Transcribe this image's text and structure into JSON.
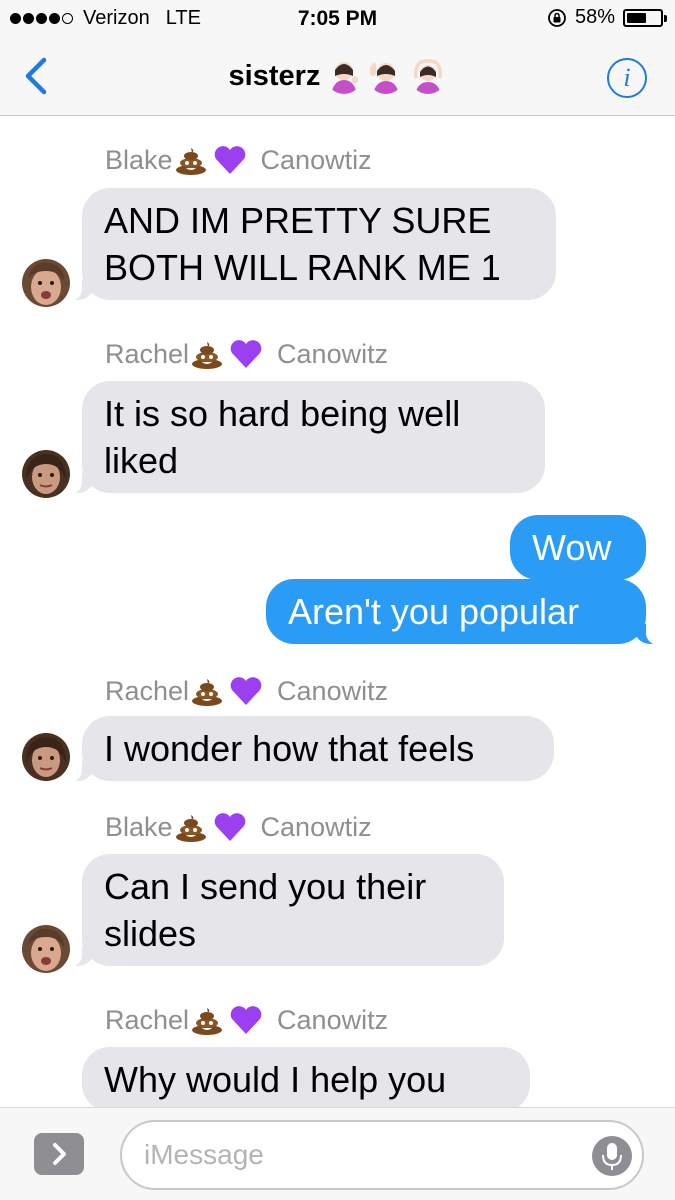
{
  "status_bar": {
    "carrier": "Verizon",
    "network": "LTE",
    "time": "7:05 PM",
    "battery_percent": "58%",
    "battery_level": 0.58,
    "signal_bars_filled": 4,
    "signal_bars_total": 5
  },
  "nav": {
    "title": "sisterz",
    "back_icon": "chevron-left-icon",
    "info_icon": "info-icon",
    "info_glyph": "i"
  },
  "messages": [
    {
      "type": "sender",
      "first": "Blake",
      "last": "Canowtiz"
    },
    {
      "type": "in",
      "text": "AND IM PRETTY SURE BOTH WILL RANK ME 1",
      "avatar": "blake"
    },
    {
      "type": "sender",
      "first": "Rachel",
      "last": "Canowitz"
    },
    {
      "type": "in",
      "text": "It is so hard being well liked",
      "avatar": "rachel"
    },
    {
      "type": "out",
      "text": "Wow"
    },
    {
      "type": "out",
      "text": "Aren't you popular"
    },
    {
      "type": "sender",
      "first": "Rachel",
      "last": "Canowitz"
    },
    {
      "type": "in",
      "text": "I wonder how that feels",
      "avatar": "rachel"
    },
    {
      "type": "sender",
      "first": "Blake",
      "last": "Canowtiz"
    },
    {
      "type": "in",
      "text": "Can I send you their slides",
      "avatar": "blake"
    },
    {
      "type": "sender",
      "first": "Rachel",
      "last": "Canowitz"
    },
    {
      "type": "in",
      "text": "Why would I help you",
      "avatar": "rachel"
    }
  ],
  "input_bar": {
    "placeholder": "iMessage",
    "apps_icon": "chevron-right-icon",
    "mic_icon": "microphone-icon"
  },
  "colors": {
    "accent": "#1f7ae0",
    "outgoing_bubble": "#2b9cf5",
    "incoming_bubble": "#e5e5ea",
    "heart": "#9b3ff0",
    "poop": "#7a4a1e"
  }
}
